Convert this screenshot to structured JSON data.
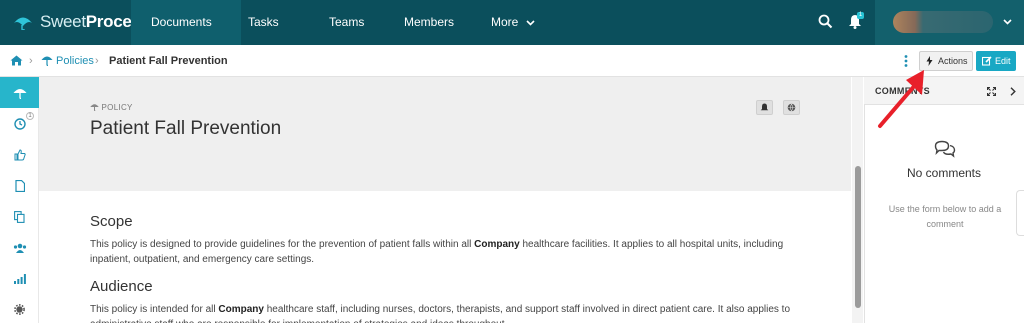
{
  "app": {
    "logo_brand": "Sweet",
    "logo_brand_bold": "Process"
  },
  "topnav": {
    "items": [
      {
        "label": "Documents"
      },
      {
        "label": "Tasks"
      },
      {
        "label": "Teams"
      },
      {
        "label": "Members"
      },
      {
        "label": "More"
      }
    ],
    "notification_count": "1"
  },
  "breadcrumb": {
    "policies_label": "Policies",
    "current": "Patient Fall Prevention"
  },
  "toolbar": {
    "actions_label": "Actions",
    "edit_label": "Edit"
  },
  "rail": {
    "history_badge": "1"
  },
  "document": {
    "type_label": "POLICY",
    "title": "Patient Fall Prevention",
    "sections": [
      {
        "heading": "Scope",
        "text_parts": [
          "This policy is designed to provide guidelines for the prevention of patient falls within all ",
          "Company",
          " healthcare facilities. It applies to all hospital units, including inpatient, outpatient, and emergency care settings."
        ]
      },
      {
        "heading": "Audience",
        "text_parts": [
          "This policy is intended for all ",
          "Company",
          " healthcare staff, including nurses, doctors, therapists, and support staff involved in direct patient care. It also applies to administrative staff who are responsible for implementation of strategies and ideas throughout"
        ]
      }
    ]
  },
  "comments": {
    "title": "COMMENTS",
    "empty_title": "No comments",
    "empty_hint": "Use the form below to add a comment"
  },
  "colors": {
    "nav_bg": "#0b4f5c",
    "accent": "#27b5cb",
    "edit_button": "#19a8c4",
    "annotation_arrow": "#e8202a"
  }
}
